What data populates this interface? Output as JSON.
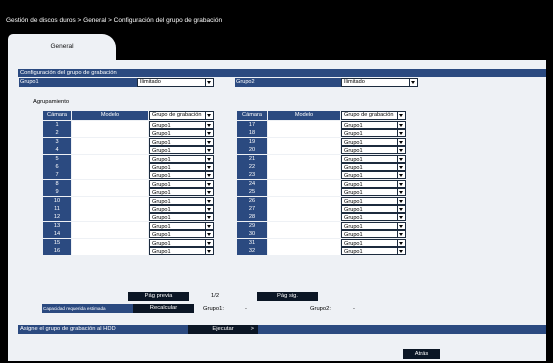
{
  "breadcrumb": "Gestión de discos duros > General > Configuración del grupo de grabación",
  "tab": "General",
  "section_title": "Configuración del grupo de grabación",
  "groups": [
    {
      "label": "Grupo1",
      "value": "Ilimitado"
    },
    {
      "label": "Grupo2",
      "value": "Ilimitado"
    }
  ],
  "grouping_title": "Agrupamiento",
  "table": {
    "headers": {
      "camera": "Cámara",
      "model": "Modelo",
      "group": "Grupo de grabación"
    },
    "left": [
      {
        "camera": "1",
        "group": "Grupo1"
      },
      {
        "camera": "2",
        "group": "Grupo1"
      },
      {
        "camera": "3",
        "group": "Grupo1"
      },
      {
        "camera": "4",
        "group": "Grupo1"
      },
      {
        "camera": "5",
        "group": "Grupo1"
      },
      {
        "camera": "6",
        "group": "Grupo1"
      },
      {
        "camera": "7",
        "group": "Grupo1"
      },
      {
        "camera": "8",
        "group": "Grupo1"
      },
      {
        "camera": "9",
        "group": "Grupo1"
      },
      {
        "camera": "10",
        "group": "Grupo1"
      },
      {
        "camera": "11",
        "group": "Grupo1"
      },
      {
        "camera": "12",
        "group": "Grupo1"
      },
      {
        "camera": "13",
        "group": "Grupo1"
      },
      {
        "camera": "14",
        "group": "Grupo1"
      },
      {
        "camera": "15",
        "group": "Grupo1"
      },
      {
        "camera": "16",
        "group": "Grupo1"
      }
    ],
    "right": [
      {
        "camera": "17",
        "group": "Grupo1"
      },
      {
        "camera": "18",
        "group": "Grupo1"
      },
      {
        "camera": "19",
        "group": "Grupo1"
      },
      {
        "camera": "20",
        "group": "Grupo1"
      },
      {
        "camera": "21",
        "group": "Grupo1"
      },
      {
        "camera": "22",
        "group": "Grupo1"
      },
      {
        "camera": "23",
        "group": "Grupo1"
      },
      {
        "camera": "24",
        "group": "Grupo1"
      },
      {
        "camera": "25",
        "group": "Grupo1"
      },
      {
        "camera": "26",
        "group": "Grupo1"
      },
      {
        "camera": "27",
        "group": "Grupo1"
      },
      {
        "camera": "28",
        "group": "Grupo1"
      },
      {
        "camera": "29",
        "group": "Grupo1"
      },
      {
        "camera": "30",
        "group": "Grupo1"
      },
      {
        "camera": "31",
        "group": "Grupo1"
      },
      {
        "camera": "32",
        "group": "Grupo1"
      }
    ]
  },
  "paging": {
    "prev": "Pág previa",
    "indicator": "1/2",
    "next": "Pág sig."
  },
  "capacity": {
    "label": "Capacidad requerida estimada",
    "button": "Recalcular",
    "g1_label": "Grupo1:",
    "g1_value": "-",
    "g2_label": "Grupo2:",
    "g2_value": "-"
  },
  "assign": {
    "label": "Asigne el grupo de grabación al HDD",
    "button": "Ejecutar"
  },
  "back": "Atrás"
}
